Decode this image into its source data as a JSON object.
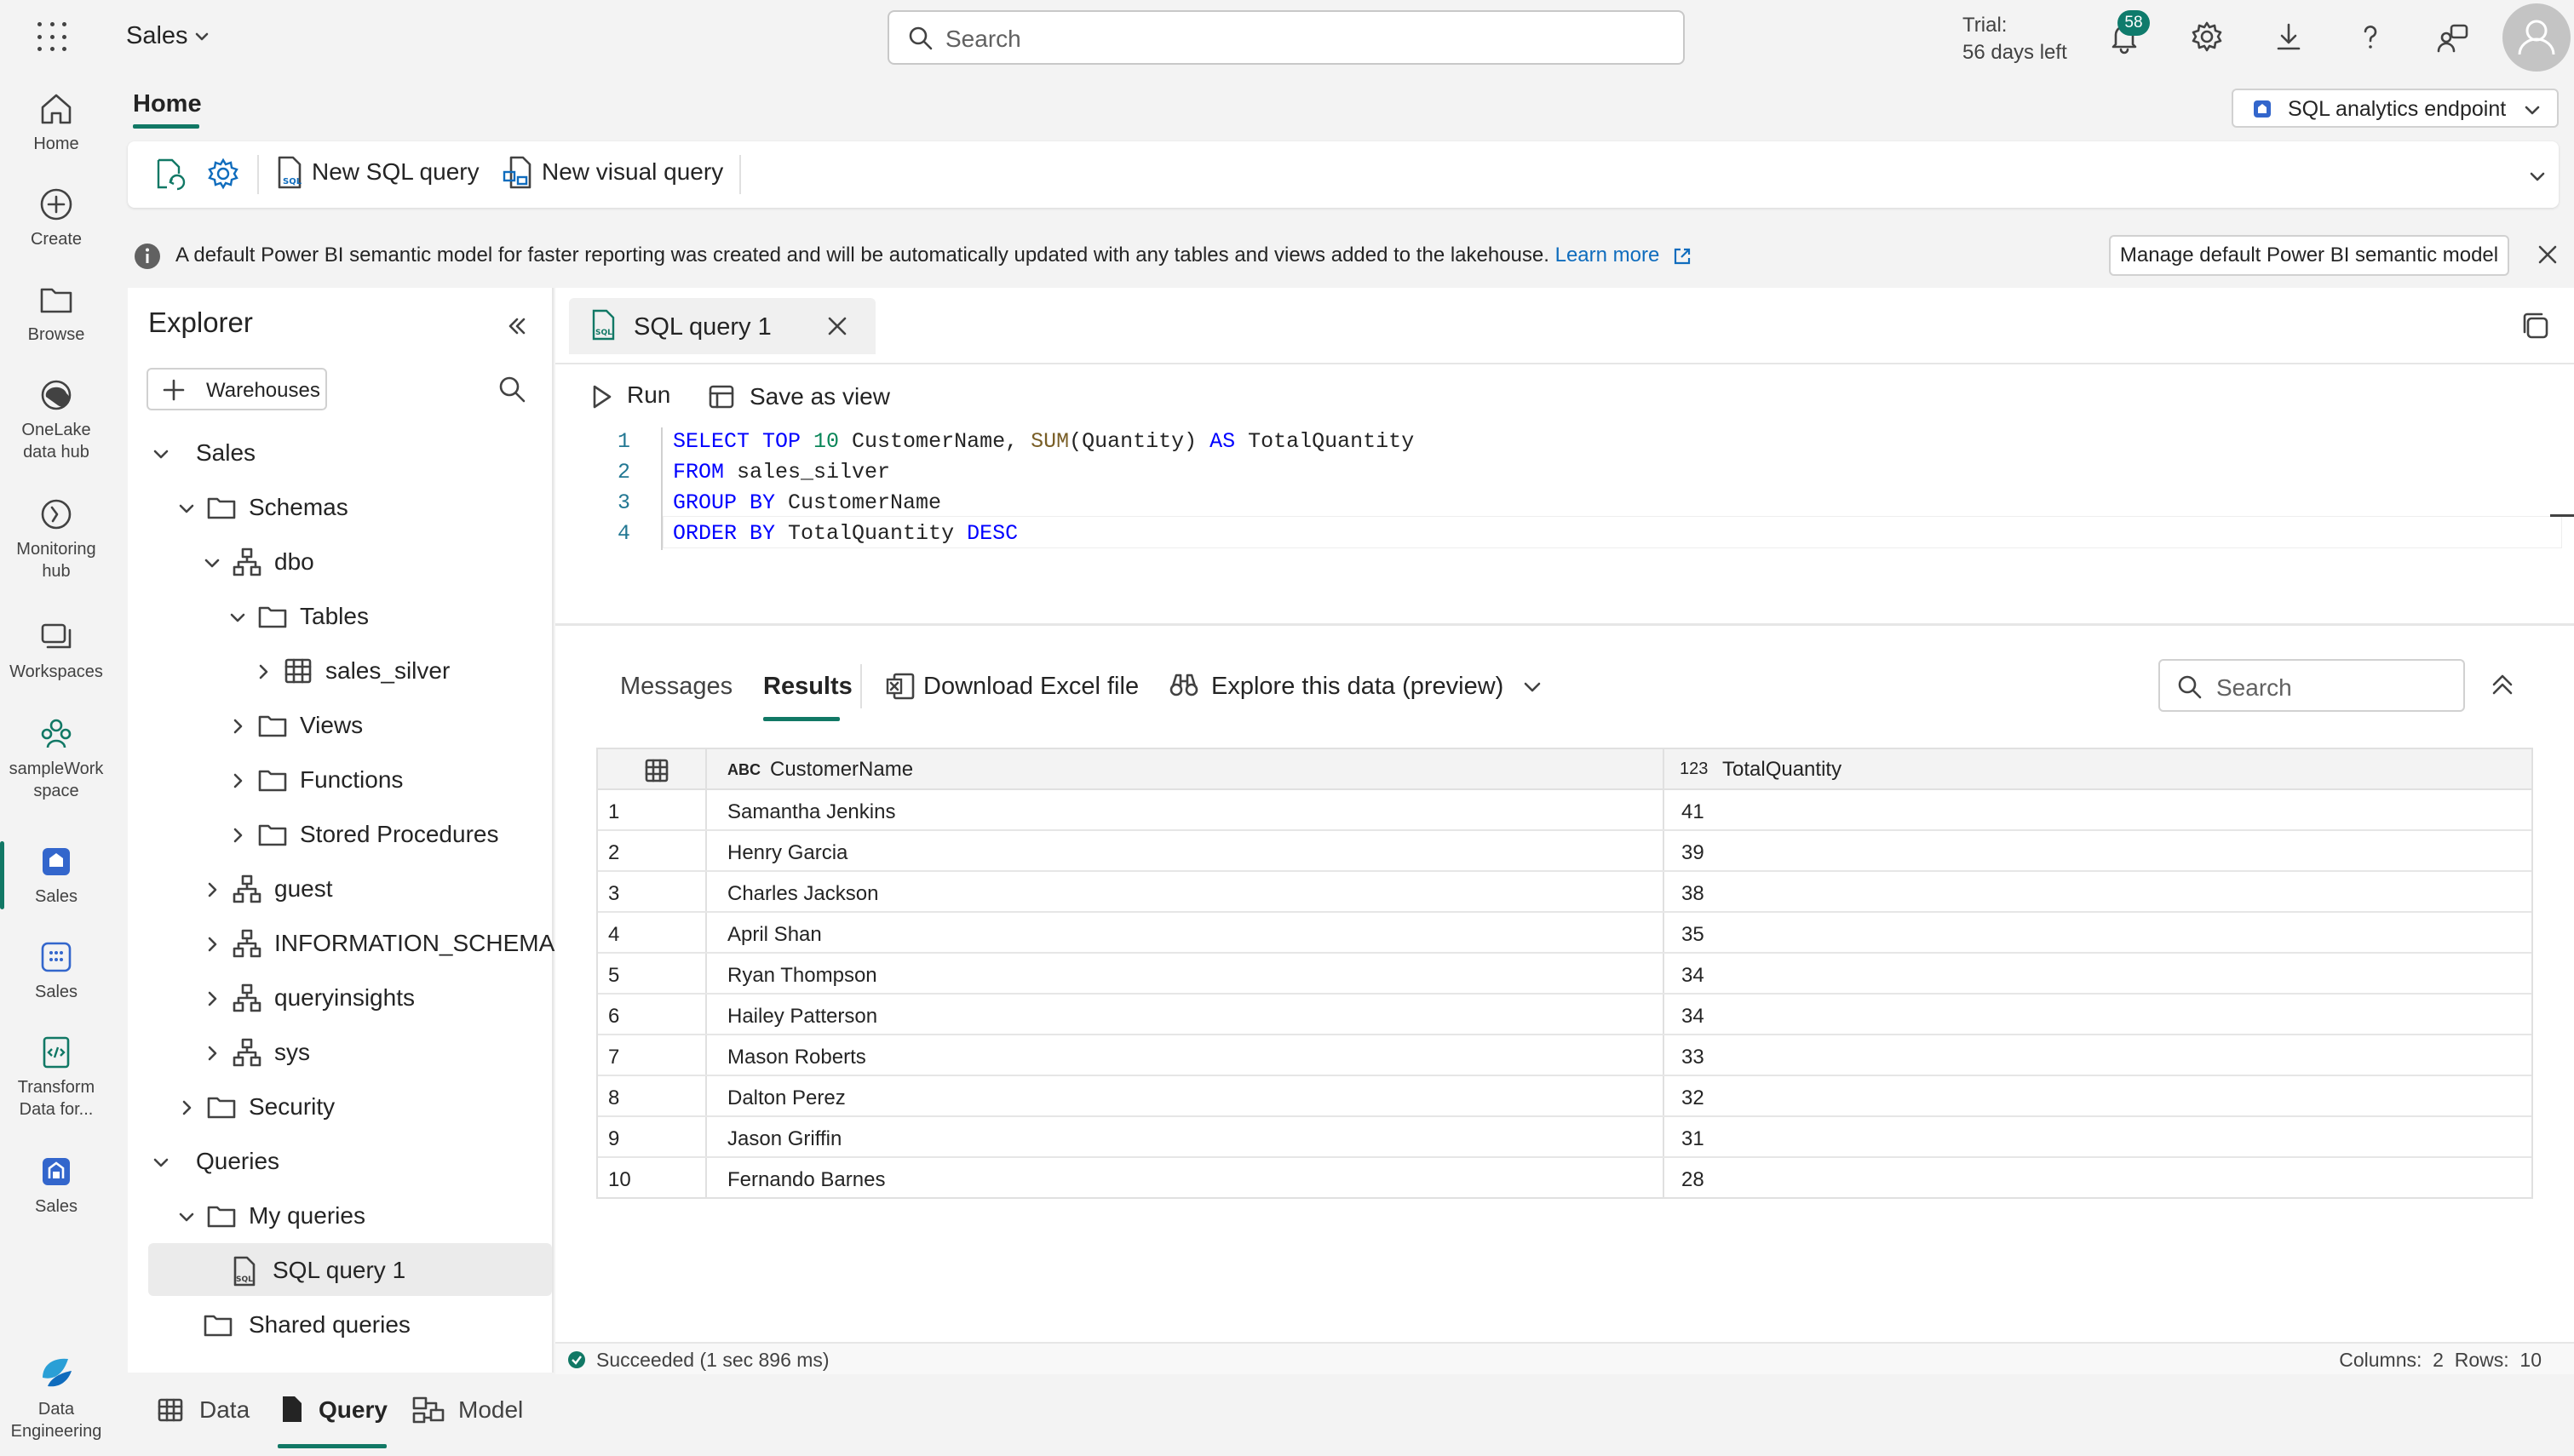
{
  "topbar": {
    "app_name": "Sales",
    "search_placeholder": "Search",
    "trial_line1": "Trial:",
    "trial_line2": "56 days left",
    "notification_count": "58"
  },
  "leftnav": {
    "items": [
      {
        "label": "Home",
        "icon": "home-icon"
      },
      {
        "label": "Create",
        "icon": "plus-circle-icon"
      },
      {
        "label": "Browse",
        "icon": "folder-icon"
      },
      {
        "label": "OneLake data hub",
        "icon": "onelake-icon"
      },
      {
        "label": "Monitoring hub",
        "icon": "monitor-icon"
      },
      {
        "label": "Workspaces",
        "icon": "workspaces-icon"
      },
      {
        "label": "sampleWork space",
        "icon": "people-icon"
      },
      {
        "label": "Sales",
        "icon": "lakehouse-icon"
      },
      {
        "label": "Sales",
        "icon": "semantic-model-icon"
      },
      {
        "label": "Transform Data for...",
        "icon": "notebook-icon"
      },
      {
        "label": "Sales",
        "icon": "warehouse-icon"
      },
      {
        "label": "Data Engineering",
        "icon": "data-engineering-icon"
      }
    ]
  },
  "ribbon": {
    "home_tab": "Home",
    "endpoint_label": "SQL analytics endpoint",
    "new_sql_query": "New SQL query",
    "new_visual_query": "New visual query"
  },
  "banner": {
    "message": "A default Power BI semantic model for faster reporting was created and will be automatically updated with any tables and views added to the lakehouse.",
    "learn_more": "Learn more",
    "manage_button": "Manage default Power BI semantic model"
  },
  "explorer": {
    "title": "Explorer",
    "warehouses_button": "Warehouses",
    "tree": {
      "sales": "Sales",
      "schemas": "Schemas",
      "dbo": "dbo",
      "tables": "Tables",
      "sales_silver": "sales_silver",
      "views": "Views",
      "functions": "Functions",
      "stored_procedures": "Stored Procedures",
      "guest": "guest",
      "information_schema": "INFORMATION_SCHEMA",
      "queryinsights": "queryinsights",
      "sys": "sys",
      "security": "Security",
      "queries": "Queries",
      "my_queries": "My queries",
      "sql_query_1": "SQL query 1",
      "shared_queries": "Shared queries"
    }
  },
  "editor": {
    "tab_title": "SQL query 1",
    "run_label": "Run",
    "save_as_view_label": "Save as view",
    "line_numbers": [
      "1",
      "2",
      "3",
      "4"
    ],
    "code": {
      "l1_kw1": "SELECT TOP ",
      "l1_num": "10",
      "l1_txt1": " CustomerName, ",
      "l1_fn": "SUM",
      "l1_txt2": "(Quantity) ",
      "l1_kw2": "AS",
      "l1_txt3": " TotalQuantity",
      "l2_kw": "FROM",
      "l2_txt": " sales_silver",
      "l3_kw": "GROUP BY",
      "l3_txt": " CustomerName",
      "l4_kw1": "ORDER BY",
      "l4_txt": " TotalQuantity ",
      "l4_kw2": "DESC"
    }
  },
  "results": {
    "messages_tab": "Messages",
    "results_tab": "Results",
    "download_excel": "Download Excel file",
    "explore_data": "Explore this data (preview)",
    "search_placeholder": "Search",
    "columns": [
      {
        "type": "ABC",
        "name": "CustomerName"
      },
      {
        "type": "123",
        "name": "TotalQuantity"
      }
    ],
    "rows": [
      [
        "1",
        "Samantha Jenkins",
        "41"
      ],
      [
        "2",
        "Henry Garcia",
        "39"
      ],
      [
        "3",
        "Charles Jackson",
        "38"
      ],
      [
        "4",
        "April Shan",
        "35"
      ],
      [
        "5",
        "Ryan Thompson",
        "34"
      ],
      [
        "6",
        "Hailey Patterson",
        "34"
      ],
      [
        "7",
        "Mason Roberts",
        "33"
      ],
      [
        "8",
        "Dalton Perez",
        "32"
      ],
      [
        "9",
        "Jason Griffin",
        "31"
      ],
      [
        "10",
        "Fernando Barnes",
        "28"
      ]
    ]
  },
  "status": {
    "message": "Succeeded (1 sec 896 ms)",
    "columns_rows": "Columns:  2  Rows:  10"
  },
  "bottom_tabs": {
    "data": "Data",
    "query": "Query",
    "model": "Model"
  },
  "colors": {
    "accent": "#117865",
    "link": "#0f6cbd",
    "badge": "#0f7b6c"
  }
}
